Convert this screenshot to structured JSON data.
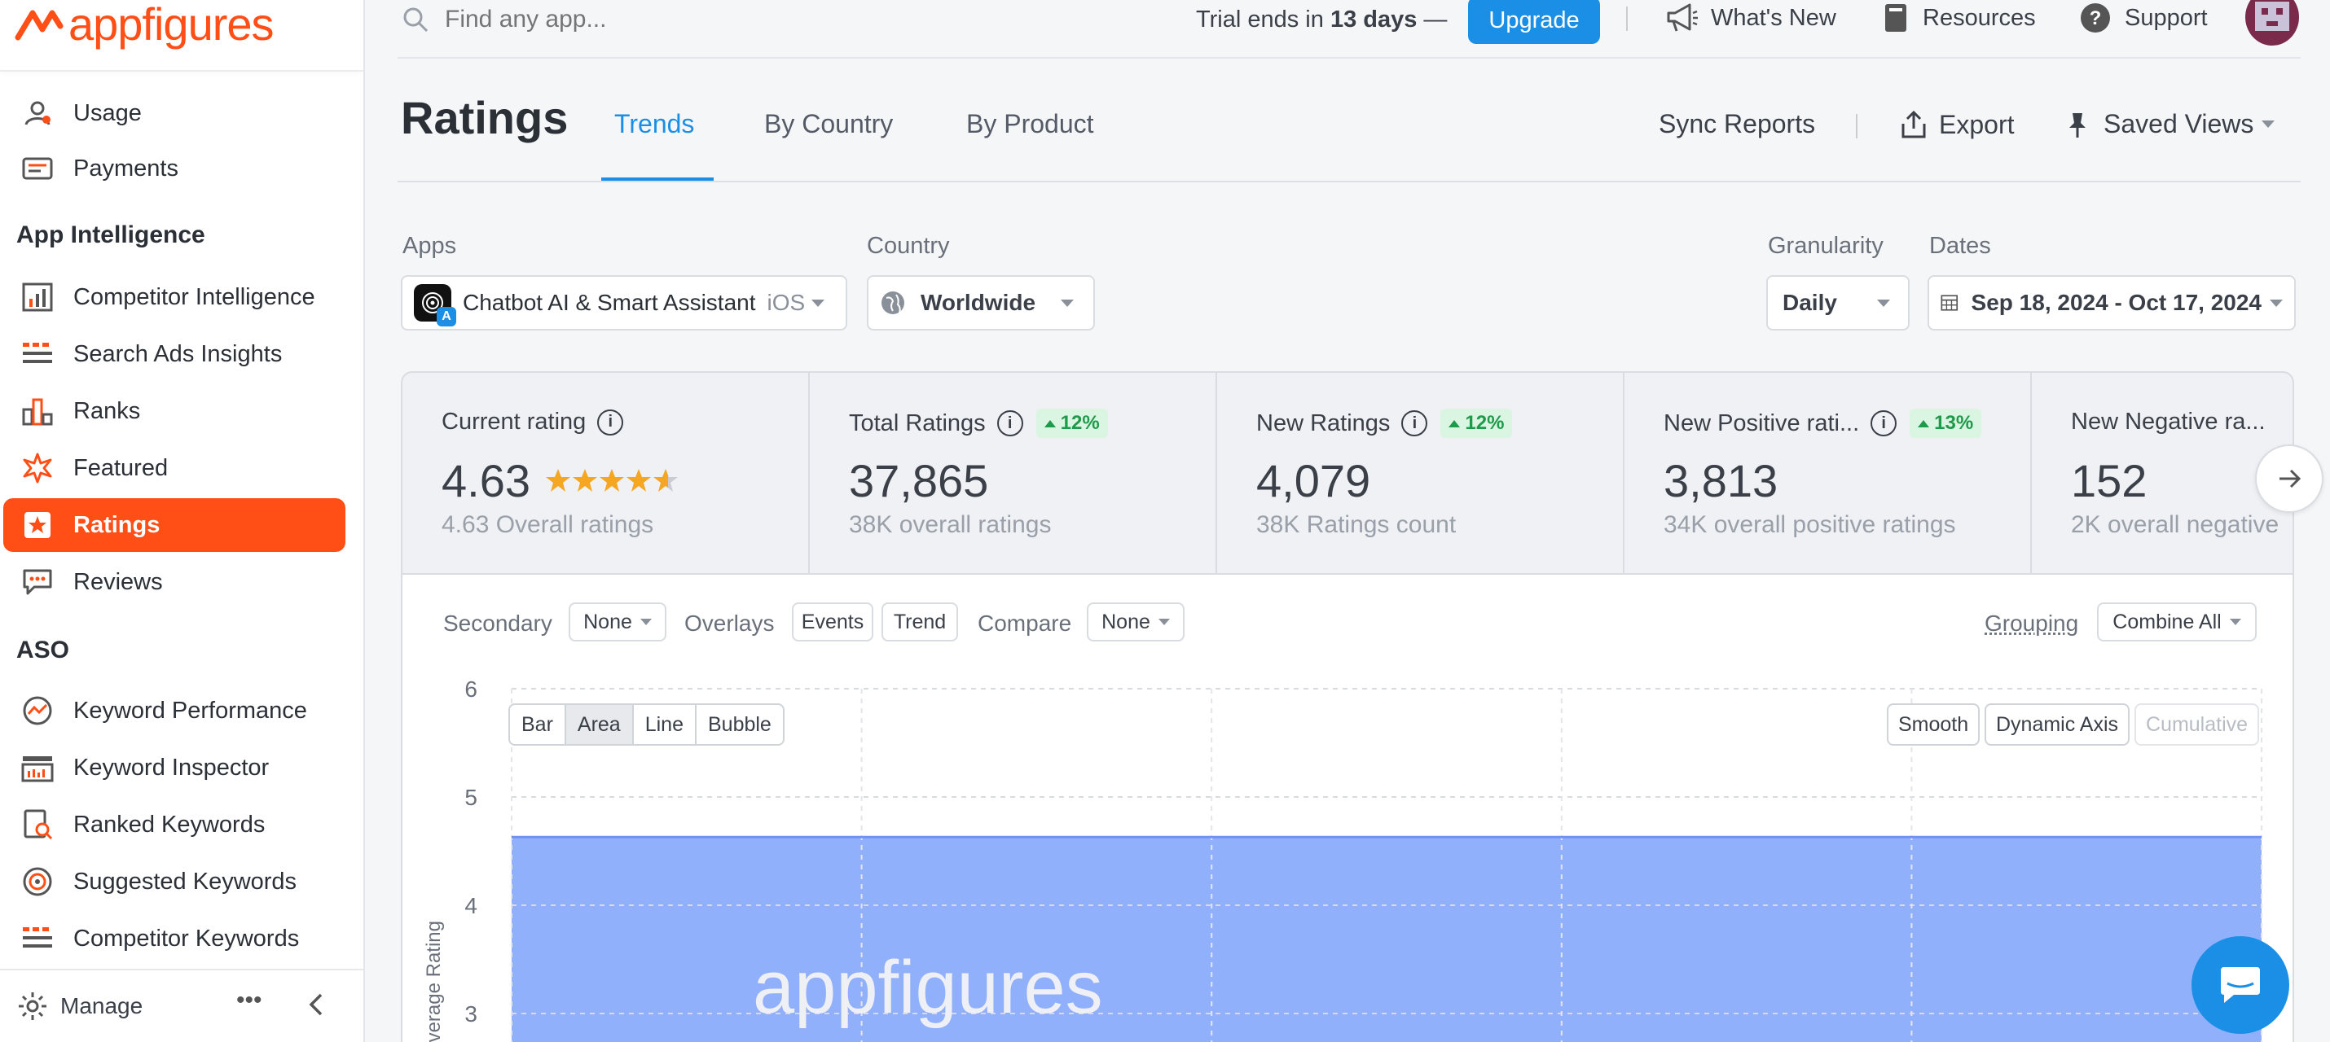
{
  "brand": {
    "name": "appfigures",
    "color": "#ff4f17"
  },
  "sidebar": {
    "items_top": [
      {
        "label": "Usage",
        "icon": "user-circle-icon"
      },
      {
        "label": "Payments",
        "icon": "receipt-icon"
      }
    ],
    "section_app_intelligence": "App Intelligence",
    "items_intel": [
      {
        "label": "Competitor Intelligence",
        "icon": "bar-chart-icon"
      },
      {
        "label": "Search Ads Insights",
        "icon": "grid-list-icon"
      },
      {
        "label": "Ranks",
        "icon": "ranks-icon"
      },
      {
        "label": "Featured",
        "icon": "starburst-icon"
      },
      {
        "label": "Ratings",
        "icon": "star-badge-icon",
        "active": true
      },
      {
        "label": "Reviews",
        "icon": "chat-bubble-icon"
      }
    ],
    "section_aso": "ASO",
    "items_aso": [
      {
        "label": "Keyword Performance",
        "icon": "trend-circle-icon"
      },
      {
        "label": "Keyword Inspector",
        "icon": "inspector-icon"
      },
      {
        "label": "Ranked Keywords",
        "icon": "doc-search-icon"
      },
      {
        "label": "Suggested Keywords",
        "icon": "target-icon"
      },
      {
        "label": "Competitor Keywords",
        "icon": "grid-list-icon"
      }
    ],
    "footer": {
      "manage": "Manage",
      "more": "•••"
    }
  },
  "topbar": {
    "search_placeholder": "Find any app...",
    "trial_prefix": "Trial ends in ",
    "trial_days": "13 days",
    "trial_suffix": " —",
    "upgrade": "Upgrade",
    "whats_new": "What's New",
    "resources": "Resources",
    "support": "Support"
  },
  "header": {
    "title": "Ratings",
    "tabs": [
      "Trends",
      "By Country",
      "By Product"
    ],
    "sync": "Sync Reports",
    "export": "Export",
    "saved_views": "Saved Views"
  },
  "filters": {
    "apps_label": "Apps",
    "app_name": "Chatbot AI & Smart Assistant",
    "app_platform": "iOS",
    "country_label": "Country",
    "country": "Worldwide",
    "granularity_label": "Granularity",
    "granularity": "Daily",
    "dates_label": "Dates",
    "dates": "Sep 18, 2024 - Oct 17, 2024"
  },
  "kpis": [
    {
      "label": "Current rating",
      "value": "4.63",
      "sub": "4.63 Overall ratings",
      "stars": 4.63
    },
    {
      "label": "Total Ratings",
      "value": "37,865",
      "sub": "38K overall ratings",
      "badge": "12%"
    },
    {
      "label": "New Ratings",
      "value": "4,079",
      "sub": "38K Ratings count",
      "badge": "12%"
    },
    {
      "label": "New Positive rati...",
      "value": "3,813",
      "sub": "34K overall positive ratings",
      "badge": "13%"
    },
    {
      "label": "New Negative ra...",
      "value": "152",
      "sub": "2K overall negative"
    }
  ],
  "chart_controls": {
    "secondary_label": "Secondary",
    "secondary": "None",
    "overlays_label": "Overlays",
    "events": "Events",
    "trend": "Trend",
    "compare_label": "Compare",
    "compare": "None",
    "grouping_label": "Grouping",
    "grouping": "Combine All",
    "types": [
      "Bar",
      "Area",
      "Line",
      "Bubble"
    ],
    "selected_type": "Area",
    "smooth": "Smooth",
    "dynamic_axis": "Dynamic Axis",
    "cumulative": "Cumulative",
    "watermark": "appfigures"
  },
  "chart_data": {
    "type": "area",
    "ylabel": "Average Rating",
    "y_ticks": [
      "6",
      "5",
      "4",
      "3"
    ],
    "ylim": [
      3,
      6
    ],
    "series": [
      {
        "values": [
          4.63,
          4.63,
          4.63,
          4.63,
          4.63,
          4.63
        ]
      }
    ],
    "color": "#8faefc",
    "grid": true
  }
}
